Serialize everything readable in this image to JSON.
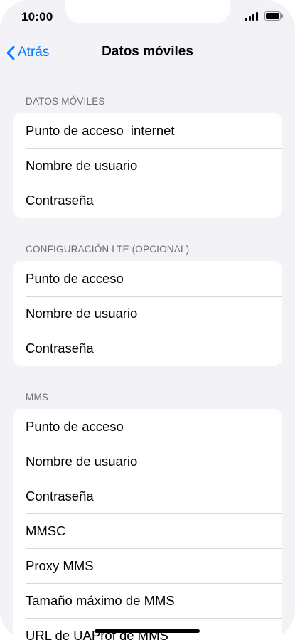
{
  "status_bar": {
    "time": "10:00"
  },
  "nav": {
    "back_label": "Atrás",
    "title": "Datos móviles"
  },
  "sections": [
    {
      "header": "DATOS MÓVILES",
      "rows": [
        {
          "label": "Punto de acceso",
          "value": "internet"
        },
        {
          "label": "Nombre de usuario",
          "value": ""
        },
        {
          "label": "Contraseña",
          "value": ""
        }
      ]
    },
    {
      "header": "CONFIGURACIÓN LTE (OPCIONAL)",
      "rows": [
        {
          "label": "Punto de acceso",
          "value": ""
        },
        {
          "label": "Nombre de usuario",
          "value": ""
        },
        {
          "label": "Contraseña",
          "value": ""
        }
      ]
    },
    {
      "header": "MMS",
      "rows": [
        {
          "label": "Punto de acceso",
          "value": ""
        },
        {
          "label": "Nombre de usuario",
          "value": ""
        },
        {
          "label": "Contraseña",
          "value": ""
        },
        {
          "label": "MMSC",
          "value": ""
        },
        {
          "label": "Proxy MMS",
          "value": ""
        },
        {
          "label": "Tamaño máximo de MMS",
          "value": ""
        },
        {
          "label": "URL de UAProf de MMS",
          "value": ""
        }
      ]
    }
  ],
  "colors": {
    "accent": "#007aff",
    "background": "#f2f2f7",
    "section_header": "#6d6d72"
  }
}
